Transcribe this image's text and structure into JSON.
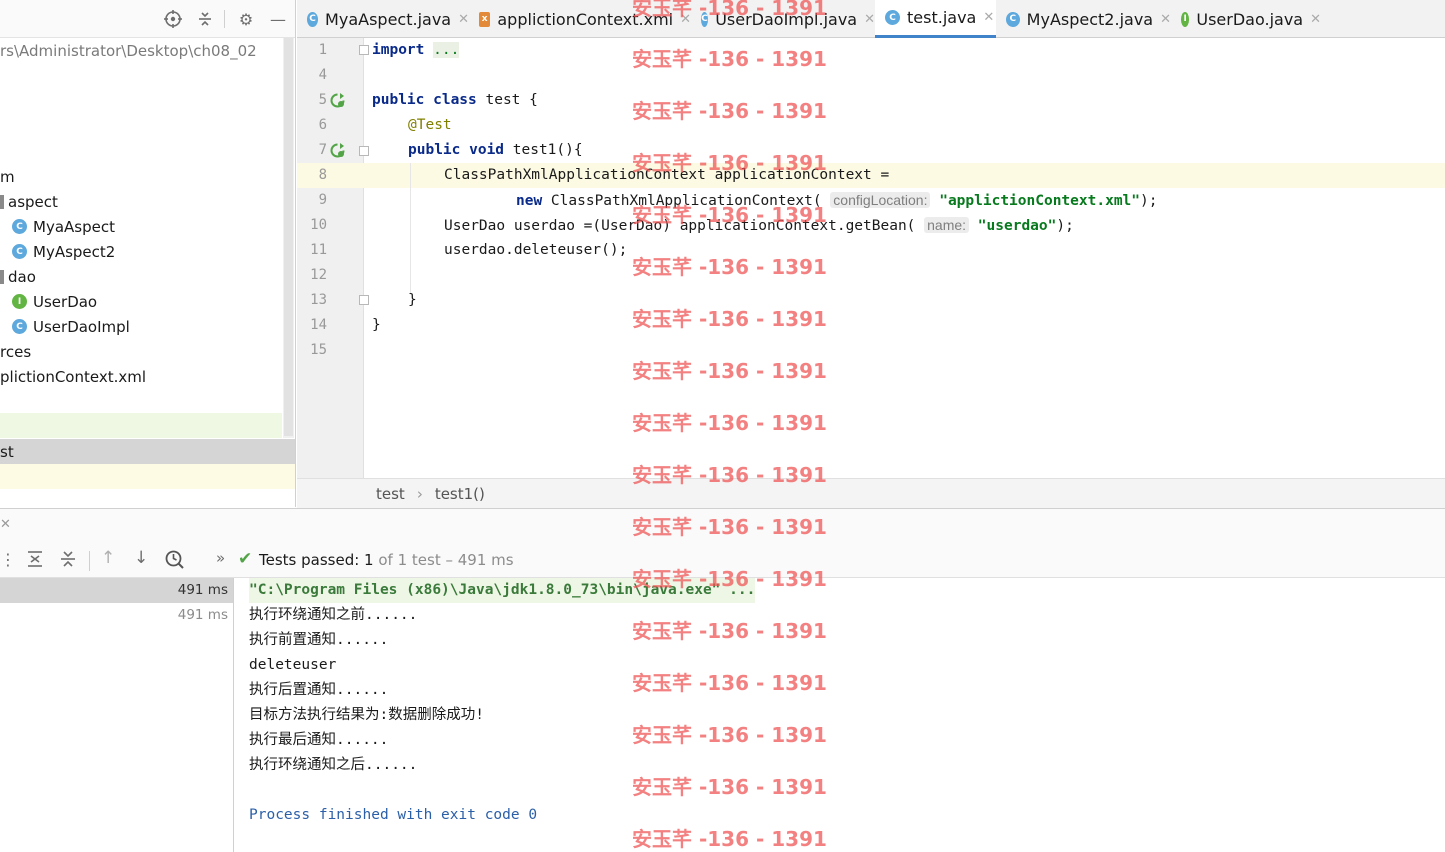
{
  "project": {
    "path": "rs\\Administrator\\Desktop\\ch08_02",
    "tree": [
      {
        "label": "m",
        "kind": "folder"
      },
      {
        "label": "aspect",
        "kind": "package"
      },
      {
        "label": "MyaAspect",
        "kind": "class"
      },
      {
        "label": "MyAspect2",
        "kind": "class"
      },
      {
        "label": "dao",
        "kind": "package"
      },
      {
        "label": "UserDao",
        "kind": "interface"
      },
      {
        "label": "UserDaoImpl",
        "kind": "class"
      },
      {
        "label": "rces",
        "kind": "folder"
      },
      {
        "label": "plictionContext.xml",
        "kind": "file"
      },
      {
        "label": "st",
        "kind": "file"
      }
    ]
  },
  "tabs": [
    {
      "label": "MyaAspect.java",
      "icon": "class-icon",
      "color": "#5da8dc"
    },
    {
      "label": "applictionContext.xml",
      "icon": "xml-icon",
      "color": "#e28a3a"
    },
    {
      "label": "UserDaoImpl.java",
      "icon": "class-icon",
      "color": "#5da8dc"
    },
    {
      "label": "test.java",
      "icon": "class-icon",
      "color": "#5da8dc",
      "active": true
    },
    {
      "label": "MyAspect2.java",
      "icon": "class-icon",
      "color": "#5da8dc"
    },
    {
      "label": "UserDao.java",
      "icon": "interface-icon",
      "color": "#62b543"
    }
  ],
  "editor": {
    "line_numbers": [
      "1",
      "4",
      "5",
      "6",
      "7",
      "8",
      "9",
      "10",
      "11",
      "12",
      "13",
      "14",
      "15"
    ],
    "code": {
      "l1_kw": "import",
      "l1_fold": "...",
      "l5_kw": "public class",
      "l5_rest": " test {",
      "l6_ann": "@Test",
      "l7_kw": "public void",
      "l7_rest": " test1(){",
      "l8": "ClassPathXmlApplicationContext applicationContext =",
      "l9_kw": "new",
      "l9_rest": " ClassPathXmlApplicationContext(",
      "l9_hint": "configLocation:",
      "l9_str": "\"applictionContext.xml\"",
      "l9_end": ");",
      "l10_rest": "UserDao userdao =(UserDao) applicationContext.getBean(",
      "l10_hint": "name:",
      "l10_str": "\"userdao\"",
      "l10_end": ");",
      "l11": "userdao.deleteuser();",
      "l13": "}",
      "l14": "}"
    }
  },
  "breadcrumb": [
    "test",
    "test1()"
  ],
  "run": {
    "status_prefix": "Tests passed: ",
    "status_count": "1",
    "status_rest": " of 1 test – 491 ms",
    "tree_times": [
      "491 ms",
      "491 ms"
    ],
    "console": [
      "\"C:\\Program Files (x86)\\Java\\jdk1.8.0_73\\bin\\java.exe\" ...",
      "执行环绕通知之前......",
      "执行前置通知......",
      "deleteuser",
      "执行后置通知......",
      "目标方法执行结果为:数据删除成功!",
      "执行最后通知......",
      "执行环绕通知之后......",
      "",
      "Process finished with exit code 0"
    ]
  },
  "watermark": "安玉芊 -136 - 1391"
}
